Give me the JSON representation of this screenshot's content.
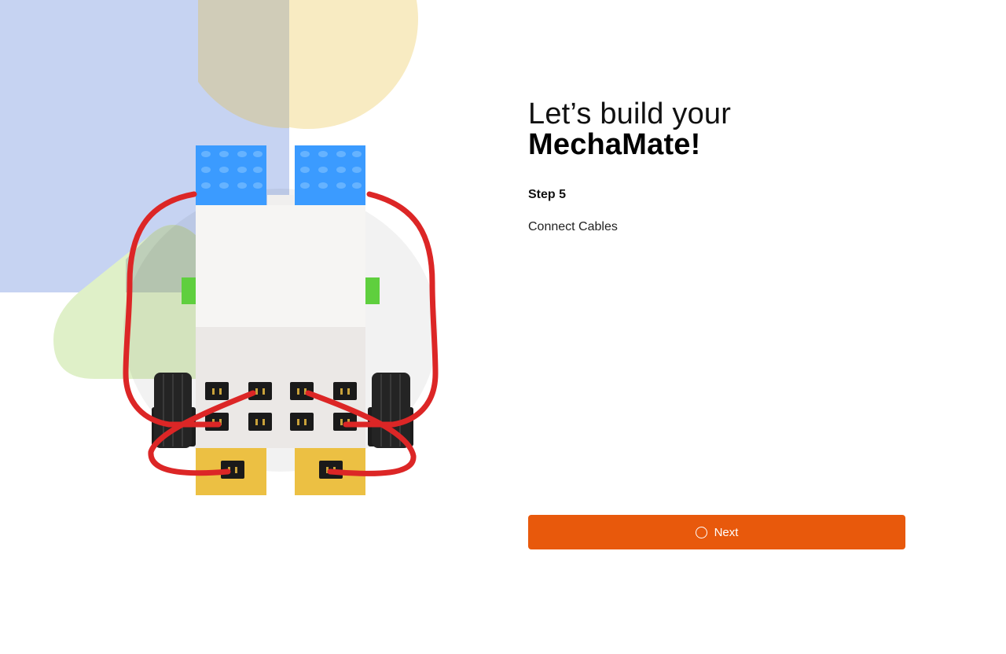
{
  "heading": {
    "line1": "Let’s build your",
    "line2": "MechaMate!"
  },
  "step": {
    "label": "Step 5",
    "instruction": "Connect Cables"
  },
  "next_button": {
    "label": "Next",
    "icon": "circle-icon"
  },
  "colors": {
    "accent": "#e8590c",
    "bg_blue": "#c6d3f2",
    "bg_yellow": "#f8ebc2",
    "bg_green": "#dff0c8",
    "cable": "#dc2626",
    "brick_blue": "#3b9bff",
    "brick_green": "#5fcf3e",
    "brick_yellow": "#ecc043"
  }
}
